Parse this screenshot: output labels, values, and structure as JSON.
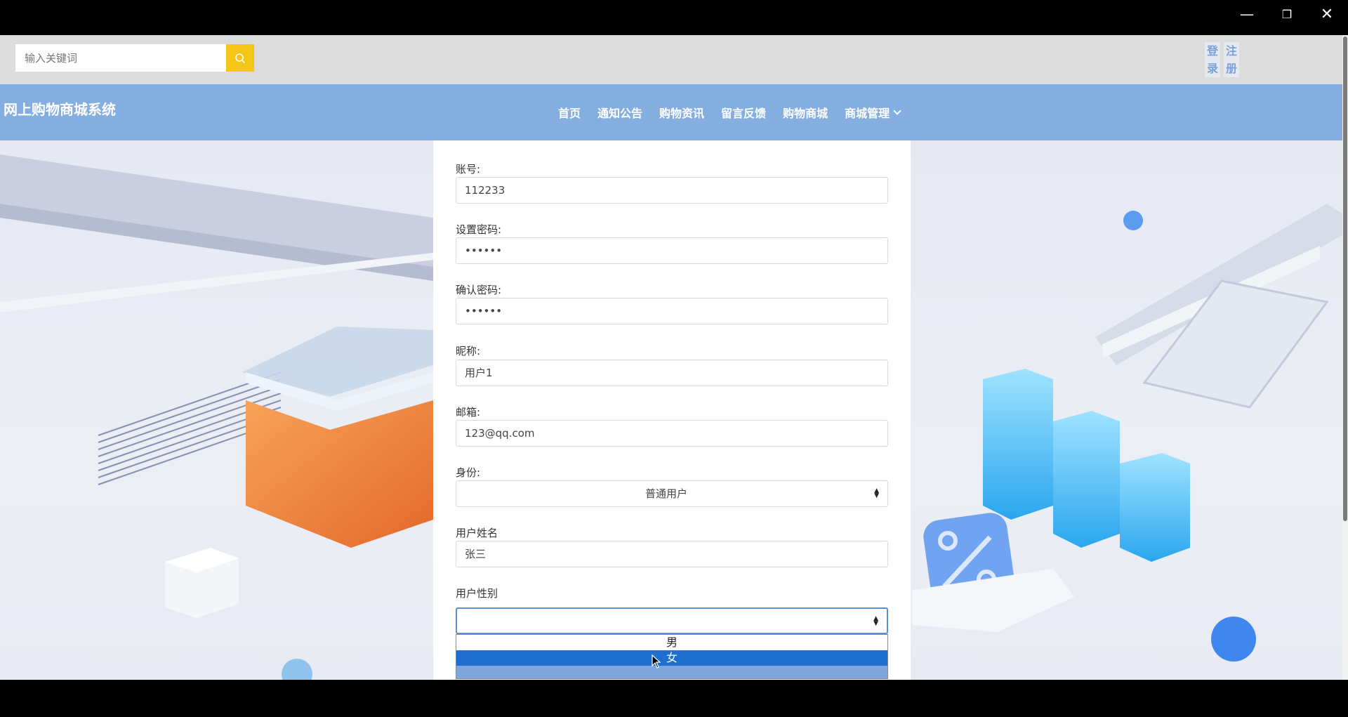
{
  "window": {
    "minimize": "—",
    "maximize": "❐",
    "close": "✕"
  },
  "search": {
    "placeholder": "输入关键词"
  },
  "auth": {
    "login": "登录",
    "register": "注册"
  },
  "header": {
    "site_title": "网上购物商城系统"
  },
  "nav": {
    "items": [
      "首页",
      "通知公告",
      "购物资讯",
      "留言反馈",
      "购物商城",
      "商城管理"
    ]
  },
  "form": {
    "account_label": "账号:",
    "account_value": "112233",
    "password_label": "设置密码:",
    "password_value": "••••••",
    "confirm_label": "确认密码:",
    "confirm_value": "••••••",
    "nickname_label": "昵称:",
    "nickname_value": "用户1",
    "email_label": "邮箱:",
    "email_value": "123@qq.com",
    "role_label": "身份:",
    "role_value": "普通用户",
    "name_label": "用户姓名",
    "name_value": "张三",
    "gender_label": "用户性别",
    "gender_value": "",
    "gender_options": [
      "男",
      "女"
    ]
  },
  "colors": {
    "nav_bg": "#84aee0",
    "search_button": "#f5c518",
    "selected_option": "#1f6fd1"
  },
  "icons": {
    "search": "search-icon",
    "chevron": "chevron-down-icon"
  }
}
